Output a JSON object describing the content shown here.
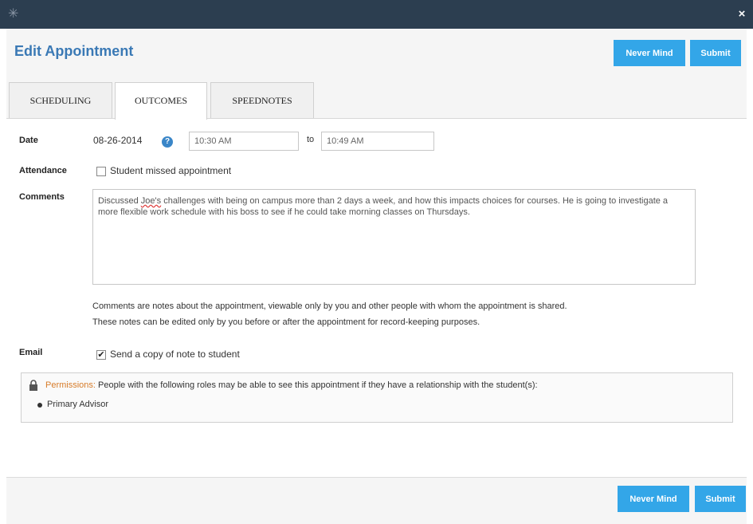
{
  "window": {
    "close_glyph": "×",
    "logo_glyph": "✳"
  },
  "header": {
    "title": "Edit Appointment",
    "never_mind_label": "Never Mind",
    "submit_label": "Submit"
  },
  "tabs": [
    {
      "label": "SCHEDULING",
      "active": false
    },
    {
      "label": "OUTCOMES",
      "active": true
    },
    {
      "label": "SPEEDNOTES",
      "active": false
    }
  ],
  "form": {
    "date_label": "Date",
    "date_value": "08-26-2014",
    "help_glyph": "?",
    "start_time": "10:30 AM",
    "to_label": "to",
    "end_time": "10:49 AM",
    "attendance_label": "Attendance",
    "attendance_option": "Student missed appointment",
    "attendance_checked": false,
    "comments_label": "Comments",
    "comments_before": "Discussed ",
    "comments_name": "Joe's",
    "comments_after": " challenges with being on campus more than 2 days a week, and how this impacts choices for courses. He is going to investigate a more flexible work schedule with his boss to see if he could take morning classes on Thursdays.",
    "comments_note_1": "Comments are notes about the appointment, viewable only by you and other people with whom the appointment is shared.",
    "comments_note_2": "These notes can be edited only by you before or after the appointment for record-keeping purposes.",
    "email_label": "Email",
    "email_option": "Send a copy of note to student",
    "email_checked": true,
    "checkmark_glyph": "✔"
  },
  "permissions": {
    "label": "Permissions:",
    "text": " People with the following roles may be able to see this appointment if they have a relationship with the student(s):",
    "roles": [
      "Primary Advisor"
    ]
  },
  "footer": {
    "never_mind_label": "Never Mind",
    "submit_label": "Submit"
  },
  "colors": {
    "accent": "#33a6e8",
    "title": "#3a79b5",
    "titlebar": "#2c3e50",
    "permission_label": "#d77c2a"
  }
}
